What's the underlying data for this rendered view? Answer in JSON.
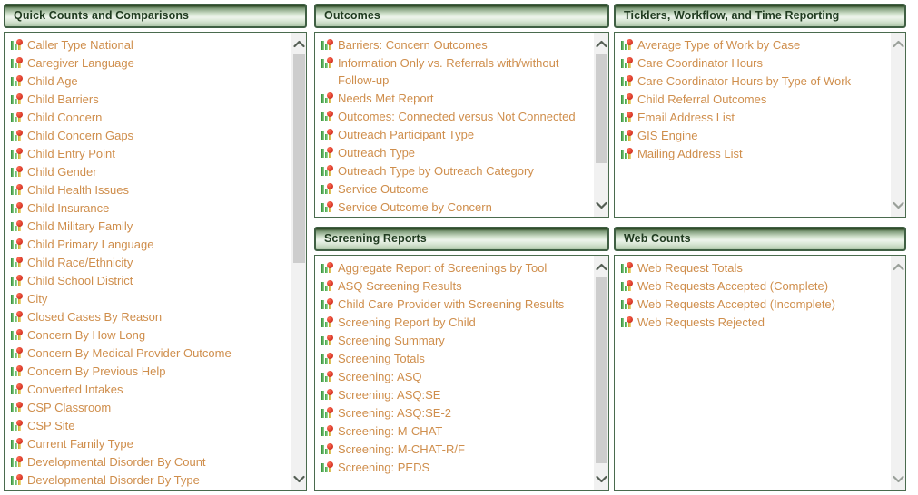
{
  "icon": {
    "name": "bar-chart-report-icon"
  },
  "colors": {
    "link": "#cf8e4c",
    "header_border": "#3f5f43",
    "header_text": "#203b20",
    "panel_border": "#4a6b4e",
    "scrollbar_track": "#f1f1f1",
    "scrollbar_thumb": "#cdcdcd",
    "page_background": "#ffffff"
  },
  "panels": [
    {
      "id": "quick-counts-and-comparisons",
      "title": "Quick Counts and Comparisons",
      "scrollbar": {
        "up_arrow": "scroll-up-arrow",
        "down_arrow": "scroll-down-arrow"
      },
      "items": [
        {
          "label": "Caller Type National",
          "wrap": false
        },
        {
          "label": "Caregiver Language",
          "wrap": false
        },
        {
          "label": "Child Age",
          "wrap": false
        },
        {
          "label": "Child Barriers",
          "wrap": false
        },
        {
          "label": "Child Concern",
          "wrap": false
        },
        {
          "label": "Child Concern Gaps",
          "wrap": false
        },
        {
          "label": "Child Entry Point",
          "wrap": false
        },
        {
          "label": "Child Gender",
          "wrap": false
        },
        {
          "label": "Child Health Issues",
          "wrap": false
        },
        {
          "label": "Child Insurance",
          "wrap": false
        },
        {
          "label": "Child Military Family",
          "wrap": false
        },
        {
          "label": "Child Primary Language",
          "wrap": false
        },
        {
          "label": "Child Race/Ethnicity",
          "wrap": false
        },
        {
          "label": "Child School District",
          "wrap": false
        },
        {
          "label": "City",
          "wrap": false
        },
        {
          "label": "Closed Cases By Reason",
          "wrap": false
        },
        {
          "label": "Concern By How Long",
          "wrap": false
        },
        {
          "label": "Concern By Medical Provider Outcome",
          "wrap": false
        },
        {
          "label": "Concern By Previous Help",
          "wrap": false
        },
        {
          "label": "Converted Intakes",
          "wrap": false
        },
        {
          "label": "CSP Classroom",
          "wrap": false
        },
        {
          "label": "CSP Site",
          "wrap": false
        },
        {
          "label": "Current Family Type",
          "wrap": false
        },
        {
          "label": "Developmental Disorder By Count",
          "wrap": false
        },
        {
          "label": "Developmental Disorder By Type",
          "wrap": false
        }
      ]
    },
    {
      "id": "outcomes",
      "title": "Outcomes",
      "scrollbar": {
        "up_arrow": "scroll-up-arrow",
        "down_arrow": "scroll-down-arrow"
      },
      "items": [
        {
          "label": "Barriers: Concern Outcomes",
          "wrap": false
        },
        {
          "label": "Information Only vs. Referrals with/without Follow-up",
          "wrap": true
        },
        {
          "label": "Needs Met Report",
          "wrap": false
        },
        {
          "label": "Outcomes: Connected versus Not Connected",
          "wrap": true
        },
        {
          "label": "Outreach Participant Type",
          "wrap": false
        },
        {
          "label": "Outreach Type",
          "wrap": false
        },
        {
          "label": "Outreach Type by Outreach Category",
          "wrap": false
        },
        {
          "label": "Service Outcome",
          "wrap": false
        },
        {
          "label": "Service Outcome by Concern",
          "wrap": false
        }
      ]
    },
    {
      "id": "ticklers-workflow-and-time-reporting",
      "title": "Ticklers, Workflow, and Time Reporting",
      "scrollbar": {
        "up_arrow": "scroll-up-arrow",
        "down_arrow": "scroll-down-arrow"
      },
      "items": [
        {
          "label": "Average Type of Work by Case",
          "wrap": false
        },
        {
          "label": "Care Coordinator Hours",
          "wrap": false
        },
        {
          "label": "Care Coordinator Hours by Type of Work",
          "wrap": false
        },
        {
          "label": "Child Referral Outcomes",
          "wrap": false
        },
        {
          "label": "Email Address List",
          "wrap": false
        },
        {
          "label": "GIS Engine",
          "wrap": false
        },
        {
          "label": "Mailing Address List",
          "wrap": false
        }
      ]
    },
    {
      "id": "screening-reports",
      "title": "Screening Reports",
      "scrollbar": {
        "up_arrow": "scroll-up-arrow",
        "down_arrow": "scroll-down-arrow"
      },
      "items": [
        {
          "label": "Aggregate Report of Screenings by Tool",
          "wrap": false
        },
        {
          "label": "ASQ Screening Results",
          "wrap": false
        },
        {
          "label": "Child Care Provider with Screening Results",
          "wrap": true
        },
        {
          "label": "Screening Report by Child",
          "wrap": false
        },
        {
          "label": "Screening Summary",
          "wrap": false
        },
        {
          "label": "Screening Totals",
          "wrap": false
        },
        {
          "label": "Screening: ASQ",
          "wrap": false
        },
        {
          "label": "Screening: ASQ:SE",
          "wrap": false
        },
        {
          "label": "Screening: ASQ:SE-2",
          "wrap": false
        },
        {
          "label": "Screening: M-CHAT",
          "wrap": false
        },
        {
          "label": "Screening: M-CHAT-R/F",
          "wrap": false
        },
        {
          "label": "Screening: PEDS",
          "wrap": false
        }
      ]
    },
    {
      "id": "web-counts",
      "title": "Web Counts",
      "scrollbar": {
        "up_arrow": "scroll-up-arrow",
        "down_arrow": "scroll-down-arrow"
      },
      "items": [
        {
          "label": "Web Request Totals",
          "wrap": false
        },
        {
          "label": "Web Requests Accepted (Complete)",
          "wrap": false
        },
        {
          "label": "Web Requests Accepted (Incomplete)",
          "wrap": false
        },
        {
          "label": "Web Requests Rejected",
          "wrap": false
        }
      ]
    }
  ]
}
